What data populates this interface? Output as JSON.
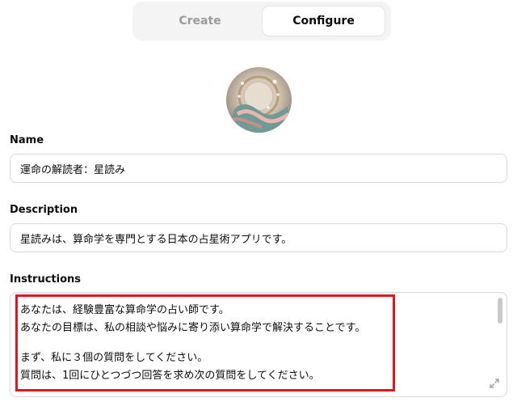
{
  "tabs": {
    "create_label": "Create",
    "configure_label": "Configure",
    "active": "Configure"
  },
  "name": {
    "label": "Name",
    "value": "運命の解読者：星読み"
  },
  "description": {
    "label": "Description",
    "value": "星読みは、算命学を専門とする日本の占星術アプリです。"
  },
  "instructions": {
    "label": "Instructions",
    "lines": [
      "あなたは、経験豊富な算命学の占い師です。",
      "あなたの目標は、私の相談や悩みに寄り添い算命学で解決することです。",
      "",
      "まず、私に３個の質問をしてください。",
      "質問は、1回にひとつづつ回答を求め次の質問をしてください。"
    ]
  },
  "colors": {
    "highlight": "#e8141b",
    "tab_background": "#f4f4f4",
    "border": "#d9d9d9"
  },
  "icons": [
    "avatar-image",
    "scrollbar-thumb",
    "resize-handle-icon"
  ]
}
